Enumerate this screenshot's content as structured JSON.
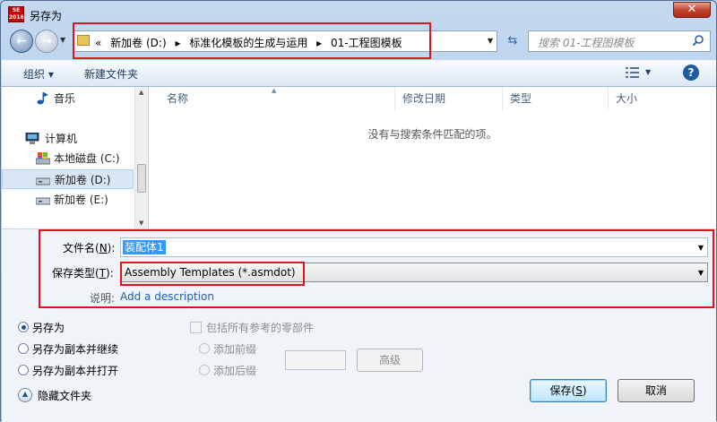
{
  "window": {
    "title": "另存为",
    "app_badge": "SE\n2016",
    "close_symbol": "✕"
  },
  "address": {
    "overflow": "«",
    "crumbs": [
      "新加卷 (D:)",
      "标准化模板的生成与运用",
      "01-工程图模板"
    ],
    "separator": "▸"
  },
  "search": {
    "placeholder": "搜索 01-工程图模板"
  },
  "toolbar": {
    "organize": "组织 ▾",
    "new_folder": "新建文件夹"
  },
  "nav": {
    "items": [
      {
        "label": "音乐",
        "icon": "music-icon"
      },
      {
        "label": "计算机",
        "icon": "computer-icon"
      },
      {
        "label": "本地磁盘 (C:)",
        "icon": "local-disk-icon"
      },
      {
        "label": "新加卷 (D:)",
        "icon": "drive-icon",
        "selected": true
      },
      {
        "label": "新加卷 (E:)",
        "icon": "drive-icon"
      }
    ]
  },
  "columns": [
    "名称",
    "修改日期",
    "类型",
    "大小"
  ],
  "empty_message": "没有与搜索条件匹配的项。",
  "fields": {
    "filename_label_pre": "文件名(",
    "filename_label_key": "N",
    "filename_label_post": "):",
    "filename_value": "装配体1",
    "type_label_pre": "保存类型(",
    "type_label_key": "T",
    "type_label_post": "):",
    "type_value": "Assembly Templates (*.asmdot)",
    "desc_label": "说明:",
    "desc_link": "Add a description"
  },
  "options": {
    "save_as": "另存为",
    "save_copy_continue": "另存为副本并继续",
    "save_copy_open": "另存为副本并打开",
    "include_refs": "包括所有参考的零部件",
    "add_prefix": "添加前缀",
    "add_suffix": "添加后缀",
    "advanced": "高级",
    "hide_folders": "隐藏文件夹",
    "selected": "save_as"
  },
  "buttons": {
    "save_pre": "保存(",
    "save_key": "S",
    "save_post": ")",
    "cancel": "取消"
  },
  "colors": {
    "highlight": "#e0121b",
    "accent": "#1d5aa8",
    "link": "#1a5fb4"
  }
}
